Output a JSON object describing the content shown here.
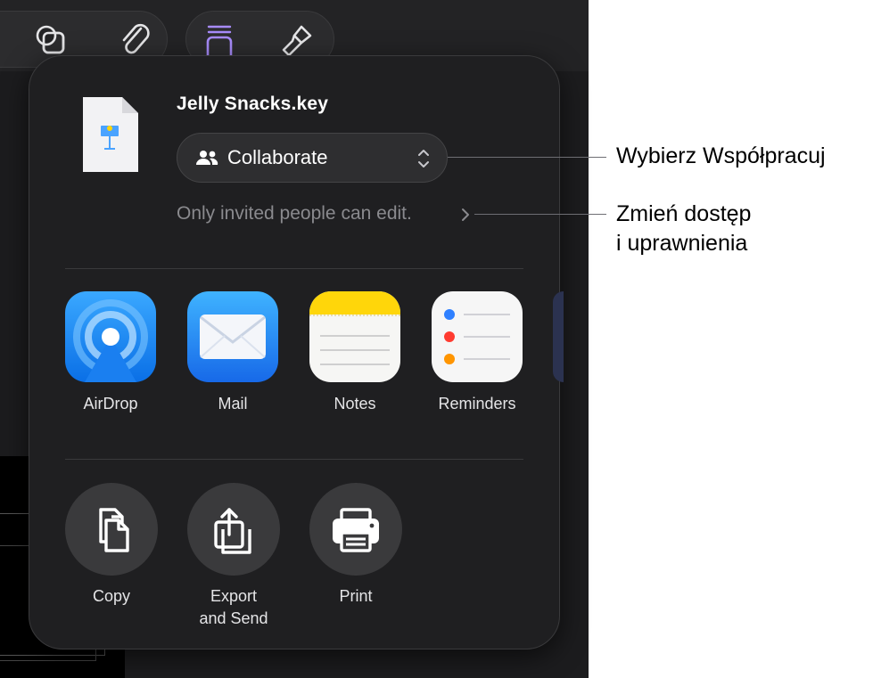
{
  "share_sheet": {
    "file_name": "Jelly Snacks.key",
    "collaborate_label": "Collaborate",
    "access_text": "Only invited people can edit.",
    "apps": [
      {
        "label": "AirDrop",
        "icon": "airdrop-icon"
      },
      {
        "label": "Mail",
        "icon": "mail-icon"
      },
      {
        "label": "Notes",
        "icon": "notes-icon"
      },
      {
        "label": "Reminders",
        "icon": "reminders-icon"
      }
    ],
    "actions": [
      {
        "label": "Copy",
        "icon": "copy-icon"
      },
      {
        "label_line1": "Export",
        "label_line2": "and Send",
        "icon": "export-icon"
      },
      {
        "label": "Print",
        "icon": "printer-icon"
      }
    ]
  },
  "toolbar": {
    "icons": [
      "shapes-icon",
      "paperclip-icon",
      "format-icon",
      "paintbrush-icon"
    ]
  },
  "callouts": {
    "collaborate": "Wybierz Współpracuj",
    "access_line1": "Zmień dostęp",
    "access_line2": "i uprawnienia"
  },
  "colors": {
    "sheet_bg": "#1f1f21",
    "accent_purple": "#a78bfa",
    "airdrop_blue": "#1a8cff",
    "notes_yellow": "#ffd60a"
  }
}
